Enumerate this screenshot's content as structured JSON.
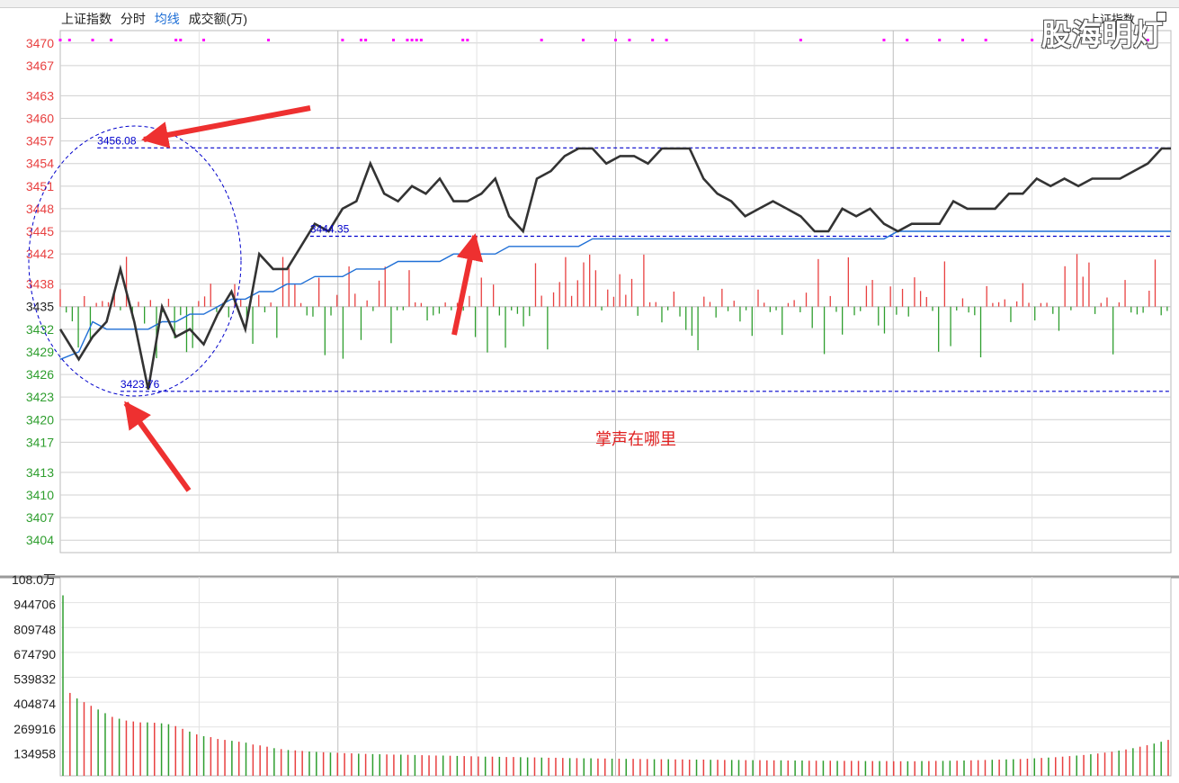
{
  "legend": {
    "name": "上证指数",
    "time": "分时",
    "avg": "均线",
    "volume": "成交额(万)"
  },
  "watermark": "股海明灯",
  "corner_tag": "上证指数",
  "annotation": "掌声在哪里",
  "colors": {
    "price": "#333333",
    "avg": "#1f6fd6",
    "up": "#e84040",
    "down": "#2e9e2e",
    "grid": "#d0d0d0",
    "dotted": "#0000cc",
    "arrow": "#ee3030",
    "marker": "#ff00ff"
  },
  "chart_data": [
    {
      "type": "line",
      "title": "",
      "base_price": 3435,
      "ylim": [
        3404,
        3470
      ],
      "y_ticks": [
        3470,
        3467,
        3463,
        3460,
        3457,
        3454,
        3451,
        3448,
        3445,
        3442,
        3438,
        3435,
        3432,
        3429,
        3426,
        3423,
        3420,
        3417,
        3413,
        3410,
        3407,
        3404
      ],
      "x_minutes": [
        0,
        4,
        7,
        10,
        13,
        16,
        19,
        22,
        25,
        28,
        31,
        34,
        37,
        40,
        43,
        46,
        49,
        52,
        55,
        58,
        61,
        64,
        67,
        70,
        73,
        76,
        79,
        82,
        85,
        88,
        91,
        94,
        97,
        100,
        103,
        106,
        109,
        112,
        115,
        118,
        121,
        124,
        127,
        130,
        133,
        136,
        139,
        142,
        145,
        148,
        151,
        154,
        157,
        160,
        163,
        166,
        169,
        172,
        175,
        178,
        181,
        184,
        187,
        190,
        193,
        196,
        199,
        202,
        205,
        208,
        211,
        214,
        217,
        220,
        223,
        226,
        229,
        232,
        235,
        238,
        240
      ],
      "series": [
        {
          "values": [
            3432,
            3428,
            3431,
            3433,
            3440,
            3433,
            3424,
            3435,
            3431,
            3432,
            3430,
            3434,
            3437,
            3432,
            3442,
            3440,
            3440,
            3443,
            3446,
            3445,
            3448,
            3449,
            3454,
            3450,
            3449,
            3451,
            3450,
            3452,
            3449,
            3449,
            3450,
            3452,
            3447,
            3445,
            3452,
            3453,
            3455,
            3456,
            3456,
            3454,
            3455,
            3455,
            3454,
            3456,
            3456,
            3456,
            3452,
            3450,
            3449,
            3447,
            3448,
            3449,
            3448,
            3447,
            3445,
            3445,
            3448,
            3447,
            3448,
            3446,
            3445,
            3446,
            3446,
            3446,
            3449,
            3448,
            3448,
            3448,
            3450,
            3450,
            3452,
            3451,
            3452,
            3451,
            3452,
            3452,
            3452,
            3453,
            3454,
            3456,
            3456
          ]
        },
        {
          "values": [
            3428,
            3429,
            3433,
            3432,
            3432,
            3432,
            3432,
            3433,
            3433,
            3434,
            3434,
            3435,
            3436,
            3436,
            3437,
            3437,
            3438,
            3438,
            3439,
            3439,
            3439,
            3440,
            3440,
            3440,
            3441,
            3441,
            3441,
            3441,
            3442,
            3442,
            3442,
            3442,
            3443,
            3443,
            3443,
            3443,
            3443,
            3443,
            3444,
            3444,
            3444,
            3444,
            3444,
            3444,
            3444,
            3444,
            3444,
            3444,
            3444,
            3444,
            3444,
            3444,
            3444,
            3444,
            3444,
            3444,
            3444,
            3444,
            3444,
            3444,
            3445,
            3445,
            3445,
            3445,
            3445,
            3445,
            3445,
            3445,
            3445,
            3445,
            3445,
            3445,
            3445,
            3445,
            3445,
            3445,
            3445,
            3445,
            3445,
            3445,
            3445
          ]
        }
      ],
      "annotations": [
        {
          "label": "3456.08",
          "value": 3456.08,
          "x_minute": 8
        },
        {
          "label": "3444.35",
          "value": 3444.35,
          "x_minute": 54
        },
        {
          "label": "3423.76",
          "value": 3423.76,
          "x_minute": 13
        }
      ],
      "markers_minutes": [
        0,
        2,
        7,
        11,
        25,
        26,
        31,
        45,
        61,
        65,
        66,
        72,
        75,
        76,
        77,
        78,
        87,
        88,
        104,
        113,
        120,
        123,
        128,
        131,
        160,
        178,
        183,
        190,
        195,
        200,
        210,
        235
      ]
    },
    {
      "type": "bar",
      "title": "",
      "y_ticks": [
        "108.0万",
        "944706",
        "809748",
        "674790",
        "539832",
        "404874",
        "269916",
        "134958"
      ],
      "ylim": [
        0,
        1080000
      ],
      "values": [
        980000,
        450000,
        420000,
        400000,
        380000,
        360000,
        340000,
        320000,
        310000,
        300000,
        295000,
        290000,
        290000,
        288000,
        285000,
        280000,
        270000,
        255000,
        240000,
        225000,
        215000,
        210000,
        200000,
        195000,
        190000,
        185000,
        180000,
        170000,
        165000,
        158000,
        150000,
        145000,
        140000,
        138000,
        135000,
        132000,
        130000,
        128000,
        126000,
        125000,
        123000,
        122000,
        120000,
        119000,
        118000,
        117000,
        116000,
        115000,
        115000,
        114000,
        113000,
        112000,
        111000,
        110000,
        110000,
        109000,
        108000,
        107000,
        106000,
        105000,
        104000,
        104000,
        103000,
        102000,
        102000,
        101000,
        100000,
        100000,
        99000,
        98000,
        98000,
        97000,
        96000,
        96000,
        95000,
        95000,
        94000,
        94000,
        93000,
        93000,
        92000,
        92000,
        91000,
        91000,
        90000,
        90000,
        90000,
        89000,
        89000,
        88000,
        88000,
        88000,
        87000,
        87000,
        86000,
        86000,
        86000,
        85000,
        85000,
        85000,
        84000,
        84000,
        84000,
        83000,
        83000,
        83000,
        82000,
        82000,
        82000,
        82000,
        81000,
        81000,
        81000,
        81000,
        80000,
        80000,
        80000,
        80000,
        79000,
        79000,
        79000,
        79000,
        80000,
        80000,
        81000,
        81000,
        82000,
        82000,
        83000,
        84000,
        85000,
        86000,
        87000,
        88000,
        89000,
        90000,
        91000,
        93000,
        95000,
        97000,
        99000,
        101000,
        104000,
        107000,
        110000,
        113000,
        117000,
        121000,
        126000,
        131000,
        137000,
        143000,
        150000,
        158000,
        166000,
        175000,
        185000,
        195000
      ]
    }
  ]
}
